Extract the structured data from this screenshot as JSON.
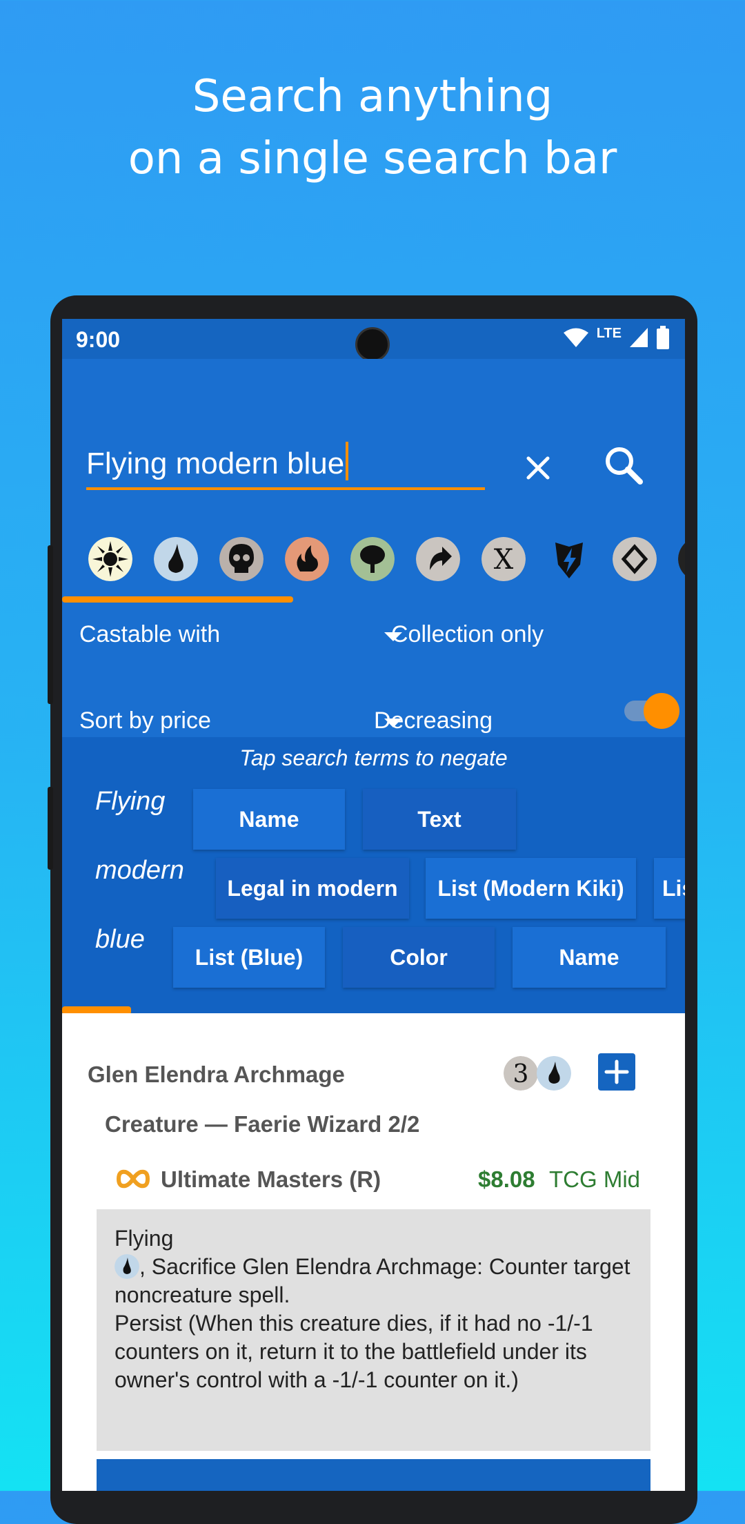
{
  "headline": {
    "line1": "Search anything",
    "line2": "on a single search bar"
  },
  "status_bar": {
    "time": "9:00",
    "network": "LTE"
  },
  "search": {
    "value": "Flying modern blue"
  },
  "mana_filters": [
    "white-sun-icon",
    "blue-drop-icon",
    "black-skull-icon",
    "red-fire-icon",
    "green-tree-icon",
    "colorless-arrow-icon",
    "x-generic-icon",
    "energy-bolt-icon",
    "diamond-icon"
  ],
  "filters": {
    "castable": "Castable with",
    "collection": "Collection only",
    "sort": "Sort by price",
    "order": "Decreasing",
    "order_toggle_on": true
  },
  "terms_hint": "Tap search terms to negate",
  "terms": [
    {
      "word": "Flying",
      "chips": [
        "Name",
        "Text"
      ]
    },
    {
      "word": "modern",
      "chips": [
        "Legal in modern",
        "List (Modern Kiki)",
        "Lis"
      ]
    },
    {
      "word": "blue",
      "chips": [
        "List (Blue)",
        "Color",
        "Name"
      ]
    }
  ],
  "card": {
    "name": "Glen Elendra Archmage",
    "cost_generic": "3",
    "type_line": "Creature — Faerie Wizard 2/2",
    "set": "Ultimate Masters (R)",
    "price": "$8.08",
    "price_source": "TCG Mid",
    "oracle": {
      "line1": "Flying",
      "line2": ", Sacrifice Glen Elendra Archmage: Counter target noncreature spell.",
      "line3": "Persist (When this creature dies, if it had no -1/-1 counters on it, return it to the battlefield under its owner's control with a -1/-1 counter on it.)"
    }
  },
  "colors": {
    "accent": "#ff8f00",
    "primary": "#1565c0",
    "price_green": "#2e7d32"
  }
}
